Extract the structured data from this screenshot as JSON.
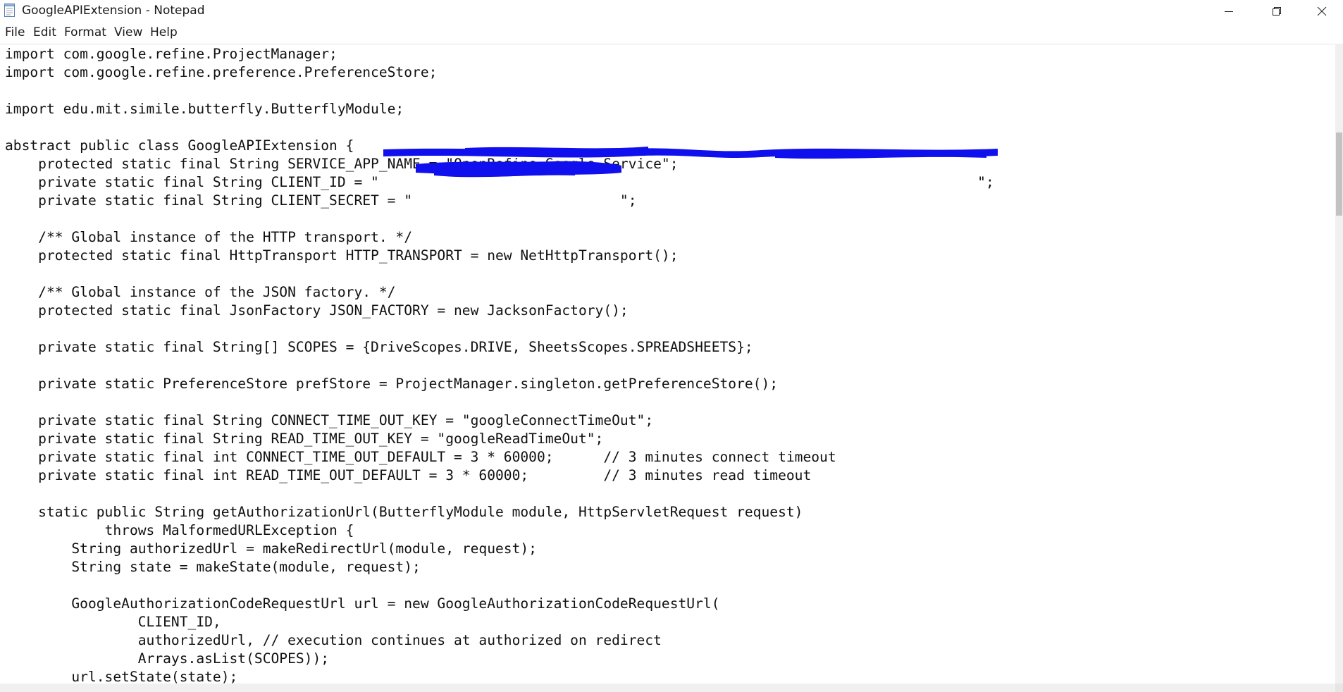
{
  "window": {
    "title": "GoogleAPIExtension - Notepad",
    "icons": {
      "app": "notepad-icon",
      "minimize": "minimize-icon",
      "maximize": "restore-icon",
      "close": "close-icon"
    }
  },
  "menu": {
    "items": [
      "File",
      "Edit",
      "Format",
      "View",
      "Help"
    ]
  },
  "editor": {
    "lines": [
      "import com.google.refine.ProjectManager;",
      "import com.google.refine.preference.PreferenceStore;",
      "",
      "import edu.mit.simile.butterfly.ButterflyModule;",
      "",
      "abstract public class GoogleAPIExtension {",
      "    protected static final String SERVICE_APP_NAME = \"OpenRefine-Google-Service\";",
      "    private static final String CLIENT_ID = \"                                                                        \";",
      "    private static final String CLIENT_SECRET = \"                         \";",
      "",
      "    /** Global instance of the HTTP transport. */",
      "    protected static final HttpTransport HTTP_TRANSPORT = new NetHttpTransport();",
      "",
      "    /** Global instance of the JSON factory. */",
      "    protected static final JsonFactory JSON_FACTORY = new JacksonFactory();",
      "",
      "    private static final String[] SCOPES = {DriveScopes.DRIVE, SheetsScopes.SPREADSHEETS};",
      "",
      "    private static PreferenceStore prefStore = ProjectManager.singleton.getPreferenceStore();",
      "",
      "    private static final String CONNECT_TIME_OUT_KEY = \"googleConnectTimeOut\";",
      "    private static final String READ_TIME_OUT_KEY = \"googleReadTimeOut\";",
      "    private static final int CONNECT_TIME_OUT_DEFAULT = 3 * 60000;      // 3 minutes connect timeout",
      "    private static final int READ_TIME_OUT_DEFAULT = 3 * 60000;         // 3 minutes read timeout",
      "",
      "    static public String getAuthorizationUrl(ButterflyModule module, HttpServletRequest request)",
      "            throws MalformedURLException {",
      "        String authorizedUrl = makeRedirectUrl(module, request);",
      "        String state = makeState(module, request);",
      "",
      "        GoogleAuthorizationCodeRequestUrl url = new GoogleAuthorizationCodeRequestUrl(",
      "                CLIENT_ID,",
      "                authorizedUrl, // execution continues at authorized on redirect",
      "                Arrays.asList(SCOPES));",
      "        url.setState(state);"
    ],
    "redaction_color": "#1010ee"
  }
}
